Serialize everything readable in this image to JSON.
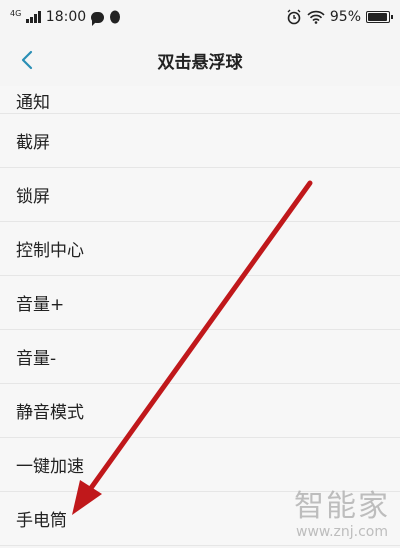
{
  "status_bar": {
    "network": "4G",
    "time": "18:00",
    "battery": "95%",
    "battery_level": 0.95,
    "icons": [
      "signal-icon",
      "message-bubble-icon",
      "penguin-icon",
      "alarm-icon",
      "wifi-icon",
      "battery-icon"
    ]
  },
  "header": {
    "title": "双击悬浮球",
    "back_icon": "chevron-left-icon"
  },
  "options": [
    "通知",
    "截屏",
    "锁屏",
    "控制中心",
    "音量+",
    "音量-",
    "静音模式",
    "一键加速",
    "手电筒"
  ],
  "annotation": {
    "arrow_color": "#c0181b"
  },
  "watermark": {
    "name": "智能家",
    "url": "www.znj.com"
  },
  "colors": {
    "accent": "#2a8fb5",
    "background": "#f5f5f5",
    "divider": "#e6e6e6"
  }
}
